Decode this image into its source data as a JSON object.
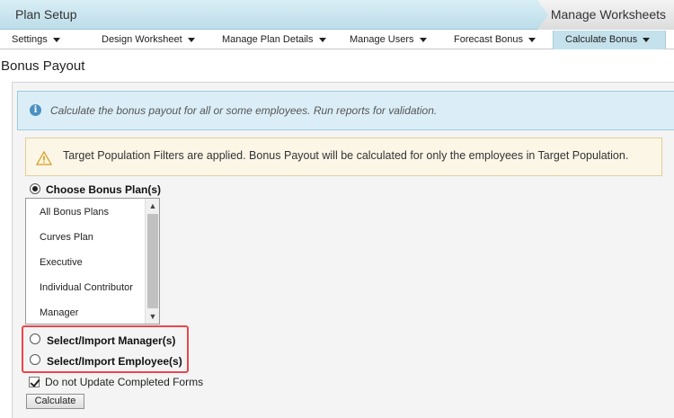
{
  "topbar": {
    "plan_setup": "Plan Setup",
    "manage_worksheets": "Manage Worksheets"
  },
  "menu": {
    "items": [
      {
        "label": "Settings"
      },
      {
        "label": "Design Worksheet"
      },
      {
        "label": "Manage Plan Details"
      },
      {
        "label": "Manage Users"
      },
      {
        "label": "Forecast Bonus"
      },
      {
        "label": "Calculate Bonus",
        "active": true
      }
    ]
  },
  "page": {
    "title": "Bonus Payout"
  },
  "info": {
    "icon": "info-icon",
    "text": "Calculate the bonus payout for all or some employees. Run reports for validation."
  },
  "warning": {
    "icon": "warning-icon",
    "text": "Target Population Filters are applied. Bonus Payout will be calculated for only the employees in Target Population."
  },
  "options": {
    "choose_plans": {
      "label": "Choose Bonus Plan(s)",
      "selected": true
    },
    "select_managers": {
      "label": "Select/Import Manager(s)",
      "selected": false
    },
    "select_employees": {
      "label": "Select/Import Employee(s)",
      "selected": false
    }
  },
  "plans": {
    "items": [
      "All Bonus Plans",
      "Curves Plan",
      "Executive",
      "Individual Contributor",
      "Manager"
    ]
  },
  "no_update": {
    "label": "Do not Update Completed Forms",
    "checked": true
  },
  "actions": {
    "calculate_label": "Calculate"
  },
  "colors": {
    "highlight": "#e8474f",
    "info_bg": "#dbeef7",
    "warning_bg": "#fbf6e6",
    "active_menu": "#c4e1ec"
  }
}
